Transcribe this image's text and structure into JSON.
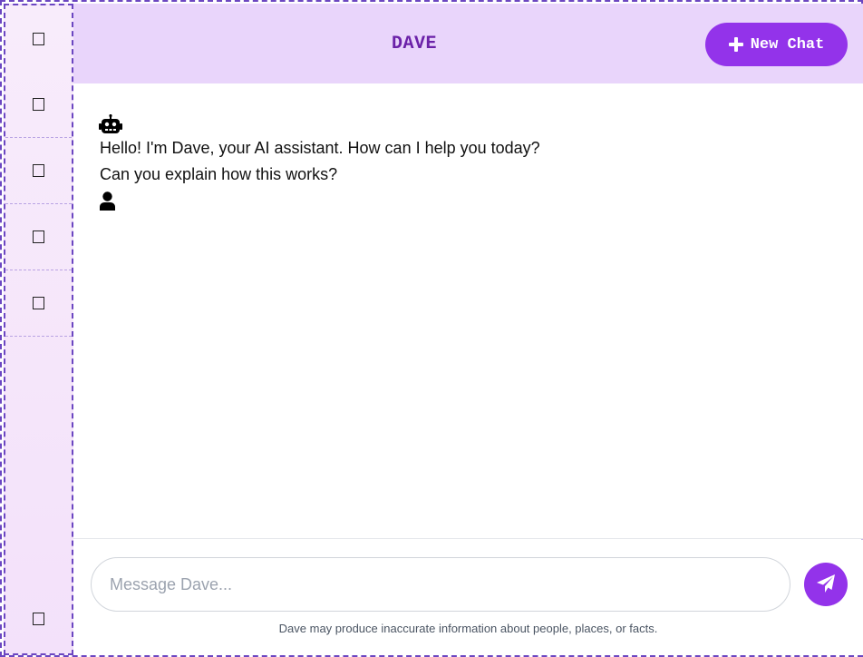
{
  "sidebar": {
    "items": [
      {
        "icon": "checkbox-icon"
      },
      {
        "icon": "checkbox-icon"
      },
      {
        "icon": "checkbox-icon"
      },
      {
        "icon": "checkbox-icon"
      },
      {
        "icon": "checkbox-icon"
      }
    ],
    "bottom_item": {
      "icon": "checkbox-icon"
    }
  },
  "header": {
    "title": "DAVE",
    "new_chat_label": "New Chat",
    "new_chat_icon": "plus-icon"
  },
  "messages": [
    {
      "role": "assistant",
      "icon": "robot-icon",
      "text": "Hello! I'm Dave, your AI assistant. How can I help you today?"
    },
    {
      "role": "user",
      "icon": "user-icon",
      "text": "Can you explain how this works?"
    }
  ],
  "composer": {
    "placeholder": "Message Dave...",
    "value": "",
    "send_icon": "paper-plane-icon",
    "disclaimer": "Dave may produce inaccurate information about people, places, or facts."
  },
  "colors": {
    "accent": "#9333ea",
    "header_bg": "#e9d5fb",
    "title": "#6b21a8",
    "border": "#6b46c1",
    "sidebar_bg": "#f5e6fb"
  }
}
